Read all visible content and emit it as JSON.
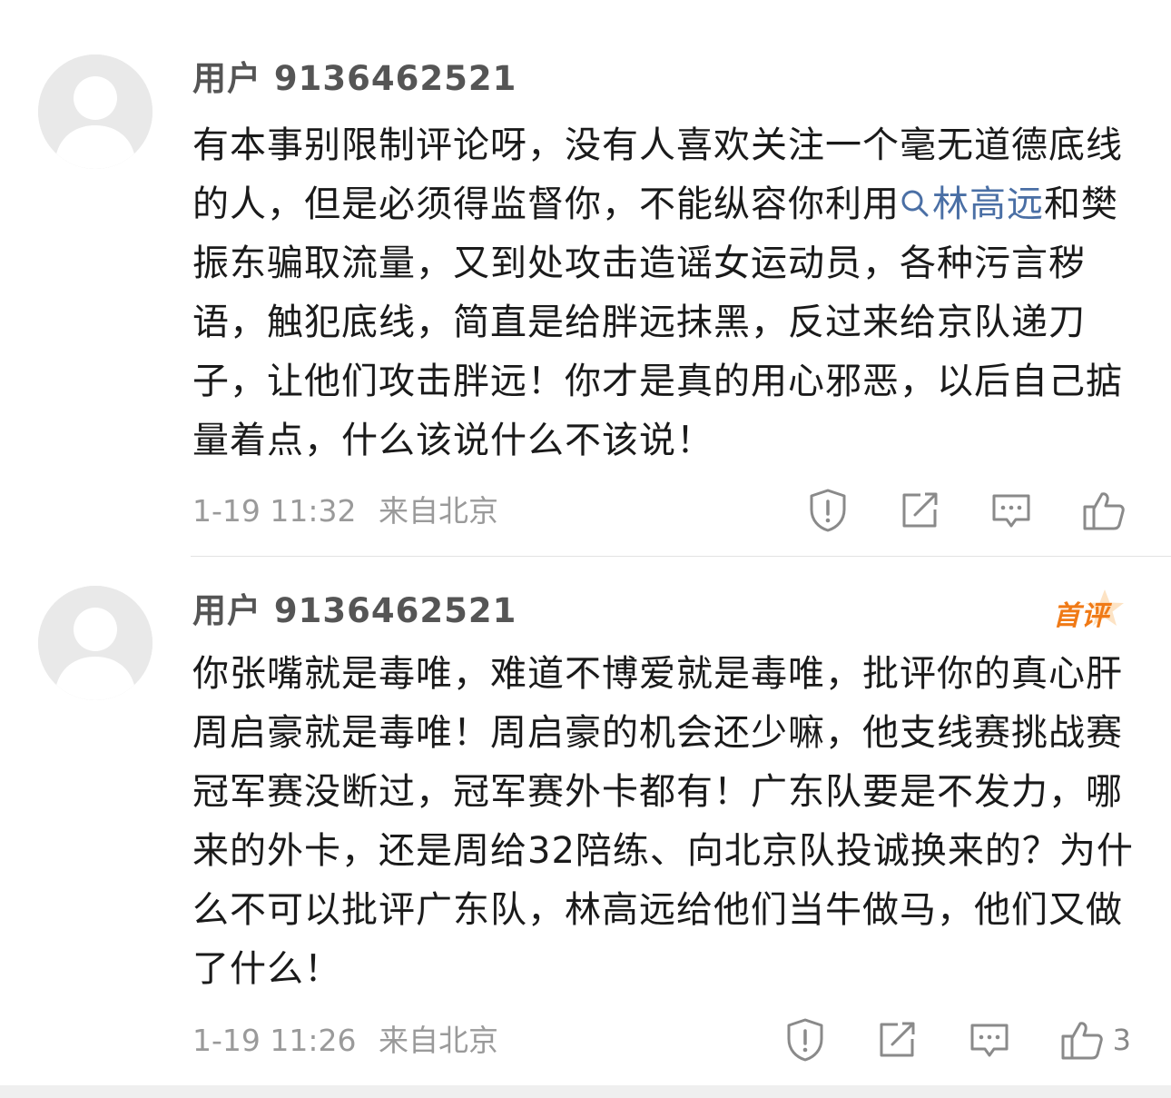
{
  "comments": [
    {
      "username": "用户 9136462521",
      "text_before": "有本事别限制评论呀，没有人喜欢关注一个毫无道德底线的人，但是必须得监督你，不能纵容你利用",
      "hashtag": "林高远",
      "text_after": "和樊振东骗取流量，又到处攻击造谣女运动员，各种污言秽语，触犯底线，简直是给胖远抹黑，反过来给京队递刀子，让他们攻击胖远！你才是真的用心邪恶，以后自己掂量着点，什么该说什么不该说！",
      "time": "1-19 11:32",
      "location": "来自北京",
      "like_count": ""
    },
    {
      "username": "用户 9136462521",
      "badge": "首评",
      "text": "你张嘴就是毒唯，难道不博爱就是毒唯，批评你的真心肝周启豪就是毒唯！周启豪的机会还少嘛，他支线赛挑战赛冠军赛没断过，冠军赛外卡都有！广东队要是不发力，哪来的外卡，还是周给32陪练、向北京队投诚换来的？为什么不可以批评广东队，林高远给他们当牛做马，他们又做了什么！",
      "time": "1-19 11:26",
      "location": "来自北京",
      "like_count": "3"
    }
  ],
  "colors": {
    "link": "#4a6fa5",
    "badge": "#f07a16",
    "meta": "#9a9a9a",
    "icon": "#8a8a8a"
  },
  "icons": [
    "report-icon",
    "share-icon",
    "reply-icon",
    "like-icon",
    "search-icon"
  ]
}
